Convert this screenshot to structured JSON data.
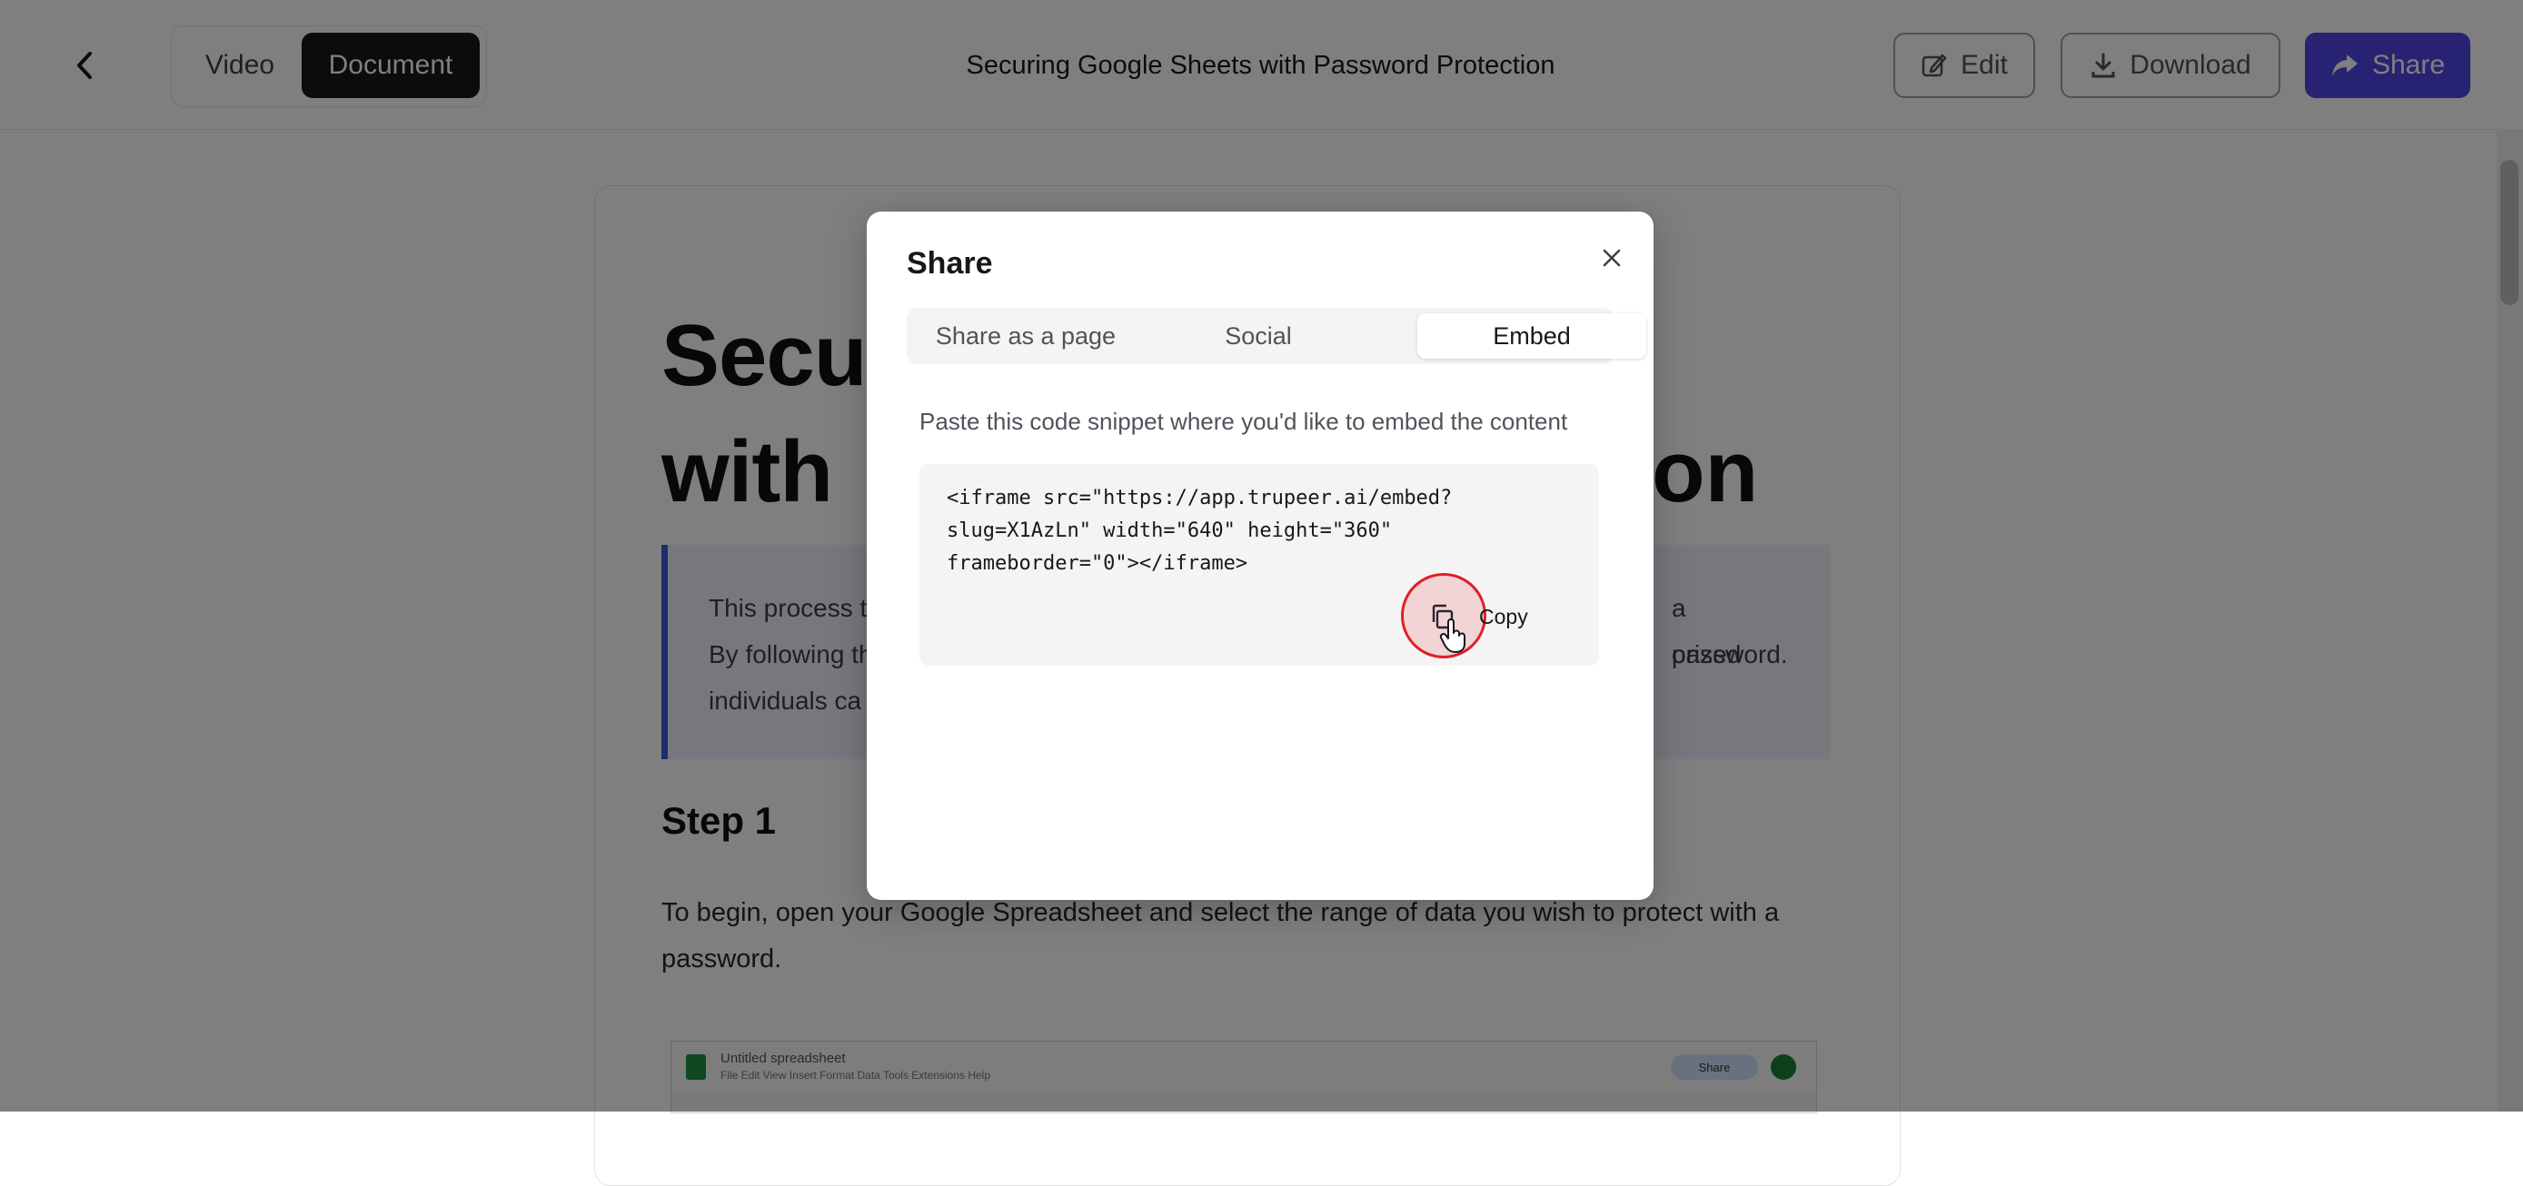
{
  "header": {
    "tabs": [
      {
        "label": "Video",
        "active": false
      },
      {
        "label": "Document",
        "active": true
      }
    ],
    "title": "Securing Google Sheets with Password Protection",
    "edit_label": "Edit",
    "download_label": "Download",
    "share_label": "Share"
  },
  "document": {
    "heading_lines": [
      "Secu",
      "with"
    ],
    "heading_right_fragment": "on",
    "callout_lines": [
      {
        "left": "This process t",
        "right": "a password."
      },
      {
        "left": "By following th",
        "right": "orized"
      },
      {
        "left": "individuals ca",
        "right": ""
      }
    ],
    "step_title": "Step 1",
    "step_text": "To begin, open your Google Spreadsheet and select the range of data you wish to protect with a password.",
    "thumbnail": {
      "title": "Untitled spreadsheet",
      "menu": "File  Edit  View  Insert  Format  Data  Tools  Extensions  Help",
      "share_label": "Share"
    }
  },
  "modal": {
    "title": "Share",
    "tabs": [
      {
        "label": "Share as a page",
        "active": false
      },
      {
        "label": "Social",
        "active": false
      },
      {
        "label": "Embed",
        "active": true
      }
    ],
    "hint": "Paste this code snippet where you'd like to embed the content",
    "code_lines": [
      "<iframe src=\"https://app.trupeer.ai/embed?",
      "slug=X1AzLn\" width=\"640\" height=\"360\"",
      "frameborder=\"0\"></iframe>"
    ],
    "copy_label": "Copy"
  },
  "icons": {
    "back": "chevron-left-icon",
    "edit": "pencil-square-icon",
    "download": "download-icon",
    "share": "share-arrow-icon",
    "close": "close-icon",
    "copy": "copy-icon",
    "cursor": "hand-pointer-icon"
  },
  "colors": {
    "accent": "#4f46e5",
    "dark": "#18181b",
    "callout_border": "#3b5bdb",
    "cursor_ring": "#e11d2a"
  }
}
